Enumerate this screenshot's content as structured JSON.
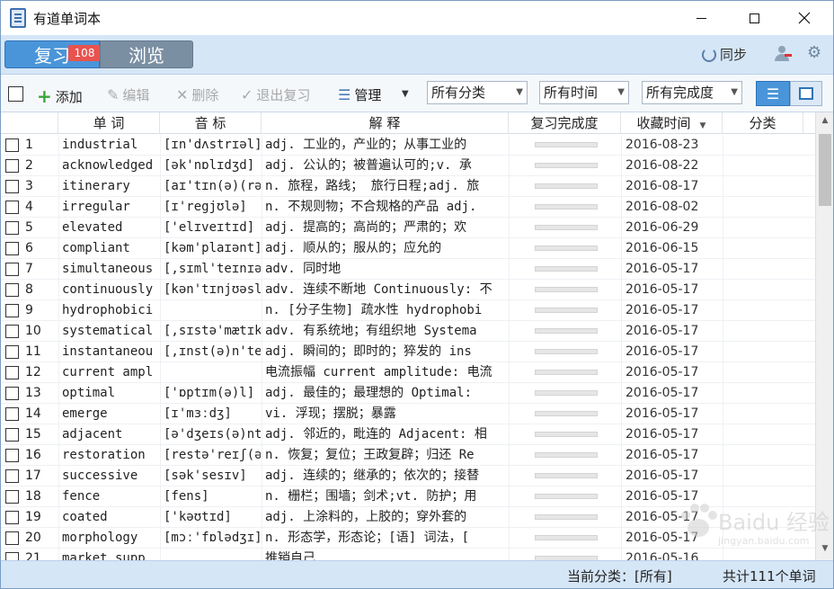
{
  "window": {
    "title": "有道单词本",
    "minimize": "—",
    "maximize": "☐",
    "close": "✕"
  },
  "nav": {
    "review_label": "复习",
    "review_badge": "108",
    "browse_label": "浏览",
    "sync_label": "同步"
  },
  "toolbar": {
    "add_label": "添加",
    "edit_label": "编辑",
    "delete_label": "删除",
    "exit_review_label": "退出复习",
    "manage_label": "管理",
    "category_select": "所有分类",
    "time_select": "所有时间",
    "completion_select": "所有完成度"
  },
  "table": {
    "headers": {
      "word": "单 词",
      "phonetic": "音 标",
      "definition": "解 释",
      "progress": "复习完成度",
      "saved_time": "收藏时间",
      "category": "分类"
    },
    "rows": [
      {
        "num": "1",
        "word": "industrial",
        "phonetic": "[ɪn'dʌstrɪəl]",
        "definition": "adj. 工业的，产业的；从事工业的",
        "progress": 0,
        "date": "2016-08-23"
      },
      {
        "num": "2",
        "word": "acknowledged",
        "phonetic": "[ək'nɒlɪdʒd]",
        "definition": "adj. 公认的；被普遍认可的;v. 承",
        "progress": 0,
        "date": "2016-08-22"
      },
      {
        "num": "3",
        "word": "itinerary",
        "phonetic": "[aɪ'tɪn(ə)(rə)",
        "definition": "n. 旅程，路线； 旅行日程;adj. 旅",
        "progress": 0,
        "date": "2016-08-17"
      },
      {
        "num": "4",
        "word": "irregular",
        "phonetic": "[ɪ'regjʊlə]",
        "definition": "n. 不规则物；不合规格的产品 adj.",
        "progress": 0,
        "date": "2016-08-02"
      },
      {
        "num": "5",
        "word": "elevated",
        "phonetic": "['elɪveɪtɪd]",
        "definition": "adj. 提高的；高尚的；严肃的；欢",
        "progress": 0,
        "date": "2016-06-29"
      },
      {
        "num": "6",
        "word": "compliant",
        "phonetic": "[kəm'plaɪənt]",
        "definition": "adj. 顺从的；服从的；应允的",
        "progress": 0,
        "date": "2016-06-15"
      },
      {
        "num": "7",
        "word": "simultaneous",
        "phonetic": "[,sɪml'teɪnɪəs",
        "definition": "adv. 同时地",
        "progress": 0,
        "date": "2016-05-17"
      },
      {
        "num": "8",
        "word": "continuously",
        "phonetic": "[kən'tɪnjʊəsl",
        "definition": "adv. 连续不断地 Continuously: 不",
        "progress": 0,
        "date": "2016-05-17"
      },
      {
        "num": "9",
        "word": "hydrophobici",
        "phonetic": "",
        "definition": "n. [分子生物] 疏水性 hydrophobi",
        "progress": 0,
        "date": "2016-05-17"
      },
      {
        "num": "10",
        "word": "systematical",
        "phonetic": "[,sɪstə'mætɪk",
        "definition": "adv. 有系统地；有组织地 Systema",
        "progress": 0,
        "date": "2016-05-17"
      },
      {
        "num": "11",
        "word": "instantaneou",
        "phonetic": "[,ɪnst(ə)n'te",
        "definition": "adj. 瞬间的；即时的；猝发的 ins",
        "progress": 0,
        "date": "2016-05-17"
      },
      {
        "num": "12",
        "word": "current ampl",
        "phonetic": "",
        "definition": "电流振幅 current amplitude: 电流",
        "progress": 0,
        "date": "2016-05-17"
      },
      {
        "num": "13",
        "word": "optimal",
        "phonetic": "['ɒptɪm(ə)l]",
        "definition": "adj. 最佳的；最理想的 Optimal:",
        "progress": 0,
        "date": "2016-05-17"
      },
      {
        "num": "14",
        "word": "emerge",
        "phonetic": "[ɪ'mɜːdʒ]",
        "definition": "vi. 浮现；摆脱；暴露",
        "progress": 0,
        "date": "2016-05-17"
      },
      {
        "num": "15",
        "word": "adjacent",
        "phonetic": "[ə'dʒeɪs(ə)nt",
        "definition": "adj. 邻近的，毗连的 Adjacent: 相",
        "progress": 0,
        "date": "2016-05-17"
      },
      {
        "num": "16",
        "word": "restoration",
        "phonetic": "[restə'reɪʃ(ə)",
        "definition": "n. 恢复；复位；王政复辟；归还 Re",
        "progress": 0,
        "date": "2016-05-17"
      },
      {
        "num": "17",
        "word": "successive",
        "phonetic": "[sək'sesɪv]",
        "definition": "adj. 连续的；继承的；依次的；接替",
        "progress": 0,
        "date": "2016-05-17"
      },
      {
        "num": "18",
        "word": "fence",
        "phonetic": "[fens]",
        "definition": "n. 栅栏；围墙；剑术;vt. 防护；用",
        "progress": 0,
        "date": "2016-05-17"
      },
      {
        "num": "19",
        "word": "coated",
        "phonetic": "['kəʊtɪd]",
        "definition": "adj. 上涂料的，上胶的；穿外套的",
        "progress": 0,
        "date": "2016-05-17"
      },
      {
        "num": "20",
        "word": "morphology",
        "phonetic": "[mɔː'fɒlədʒɪ]",
        "definition": "n. 形态学，形态论；[语] 词法，[",
        "progress": 0,
        "date": "2016-05-17"
      },
      {
        "num": "21",
        "word": "market supp",
        "phonetic": "",
        "definition": "推销自己",
        "progress": 0,
        "date": "2016-05-16"
      }
    ]
  },
  "status": {
    "current_category": "当前分类：[所有]",
    "total": "共计111个单词"
  },
  "watermark": {
    "text": "Baidu 经验",
    "sub": "jingyan.baidu.com"
  },
  "colors": {
    "accent": "#4a95d9",
    "nav_bg": "#d5e6f7",
    "badge": "#e8534f",
    "add_green": "#3aa33a"
  }
}
